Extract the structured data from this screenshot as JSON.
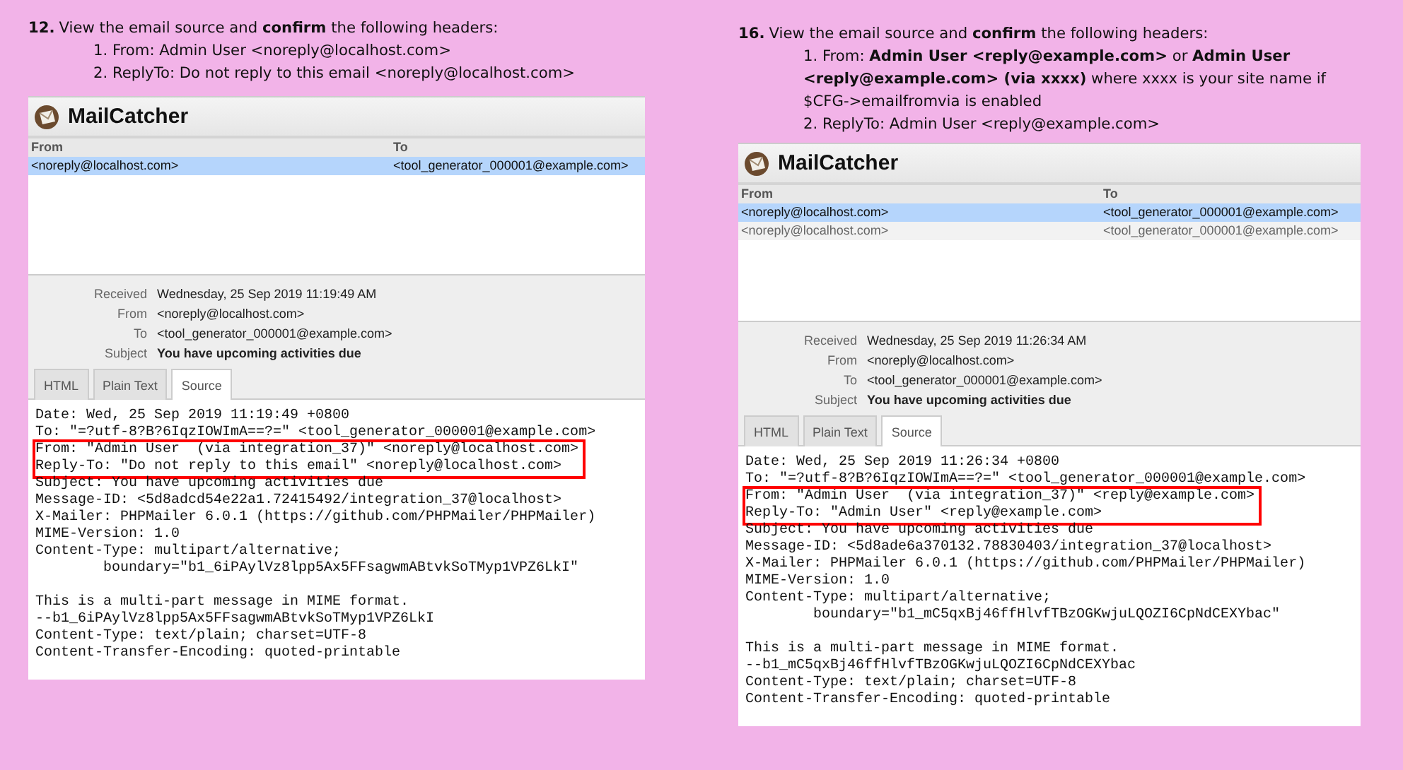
{
  "panels": [
    {
      "step": {
        "number": "12.",
        "intro": "View the email source and **confirm** the  following headers:",
        "items": [
          "1. From: Admin User <noreply@localhost.com>",
          "2. ReplyTo: Do not reply to this email <noreply@localhost.com>"
        ]
      },
      "mailcatcher": {
        "title": "MailCatcher",
        "columns": [
          "From",
          "To"
        ],
        "rows": [
          {
            "from": "<noreply@localhost.com>",
            "to": "<tool_generator_000001@example.com>",
            "selected": true
          }
        ],
        "headers": [
          {
            "label": "Received",
            "value": "Wednesday, 25 Sep 2019 11:19:49 AM",
            "kind": "plain"
          },
          {
            "label": "From",
            "value": "<noreply@localhost.com>",
            "kind": "plain"
          },
          {
            "label": "To",
            "value": "<tool_generator_000001@example.com>",
            "kind": "plain"
          },
          {
            "label": "Subject",
            "value": "You have upcoming activities due",
            "kind": "subject"
          }
        ],
        "tabs": [
          {
            "label": "HTML",
            "selected": false
          },
          {
            "label": "Plain Text",
            "selected": false
          },
          {
            "label": "Source",
            "selected": true
          }
        ],
        "source": [
          [
            {
              "highlighted": false,
              "lines": [
                "Date: Wed, 25 Sep 2019 11:19:49 +0800",
                "To: \"=?utf-8?B?6IqzIOWImA==?=\" <tool_generator_000001@example.com>"
              ]
            },
            {
              "highlighted": true,
              "lines": [
                "From: \"Admin User  (via integration_37)\" <noreply@localhost.com>",
                "Reply-To: \"Do not reply to this email\" <noreply@localhost.com>"
              ]
            },
            {
              "highlighted": false,
              "lines": [
                "Subject: You have upcoming activities due",
                "Message-ID: <5d8adcd54e22a1.72415492/integration_37@localhost>",
                "X-Mailer: PHPMailer 6.0.1 (https://github.com/PHPMailer/PHPMailer)",
                "MIME-Version: 1.0",
                "Content-Type: multipart/alternative;",
                "        boundary=\"b1_6iPAylVz8lpp5Ax5FFsagwmABtvkSoTMyp1VPZ6LkI\""
              ]
            }
          ],
          [
            {
              "highlighted": false,
              "lines": [
                "This is a multi-part message in MIME format.",
                "--b1_6iPAylVz8lpp5Ax5FFsagwmABtvkSoTMyp1VPZ6LkI",
                "Content-Type: text/plain; charset=UTF-8",
                "Content-Transfer-Encoding: quoted-printable"
              ]
            }
          ]
        ]
      }
    },
    {
      "step": {
        "number": "16.",
        "intro": "View the email source and **confirm** the  following headers:",
        "items": [
          "1. From: **Admin User <reply@example.com>**  or **Admin User <reply@example.com>  (via xxxx)** where xxxx is your site name  if $CFG->emailfromvia is enabled",
          "2. ReplyTo: Admin User <reply@example.com>"
        ]
      },
      "mailcatcher": {
        "title": "MailCatcher",
        "columns": [
          "From",
          "To"
        ],
        "rows": [
          {
            "from": "<noreply@localhost.com>",
            "to": "<tool_generator_000001@example.com>",
            "selected": true
          },
          {
            "from": "<noreply@localhost.com>",
            "to": "<tool_generator_000001@example.com>",
            "selected": false
          }
        ],
        "headers": [
          {
            "label": "Received",
            "value": "Wednesday, 25 Sep 2019 11:26:34 AM",
            "kind": "plain"
          },
          {
            "label": "From",
            "value": "<noreply@localhost.com>",
            "kind": "plain"
          },
          {
            "label": "To",
            "value": "<tool_generator_000001@example.com>",
            "kind": "plain"
          },
          {
            "label": "Subject",
            "value": "You have upcoming activities due",
            "kind": "subject"
          }
        ],
        "tabs": [
          {
            "label": "HTML",
            "selected": false
          },
          {
            "label": "Plain Text",
            "selected": false
          },
          {
            "label": "Source",
            "selected": true
          }
        ],
        "source": [
          [
            {
              "highlighted": false,
              "lines": [
                "Date: Wed, 25 Sep 2019 11:26:34 +0800",
                "To: \"=?utf-8?B?6IqzIOWImA==?=\" <tool_generator_000001@example.com>"
              ]
            },
            {
              "highlighted": true,
              "lines": [
                "From: \"Admin User  (via integration_37)\" <reply@example.com>",
                "Reply-To: \"Admin User\" <reply@example.com>"
              ]
            },
            {
              "highlighted": false,
              "lines": [
                "Subject: You have upcoming activities due",
                "Message-ID: <5d8ade6a370132.78830403/integration_37@localhost>",
                "X-Mailer: PHPMailer 6.0.1 (https://github.com/PHPMailer/PHPMailer)",
                "MIME-Version: 1.0",
                "Content-Type: multipart/alternative;",
                "        boundary=\"b1_mC5qxBj46ffHlvfTBzOGKwjuLQOZI6CpNdCEXYbac\""
              ]
            }
          ],
          [
            {
              "highlighted": false,
              "lines": [
                "This is a multi-part message in MIME format.",
                "--b1_mC5qxBj46ffHlvfTBzOGKwjuLQOZI6CpNdCEXYbac",
                "Content-Type: text/plain; charset=UTF-8",
                "Content-Transfer-Encoding: quoted-printable"
              ]
            }
          ]
        ]
      }
    }
  ]
}
